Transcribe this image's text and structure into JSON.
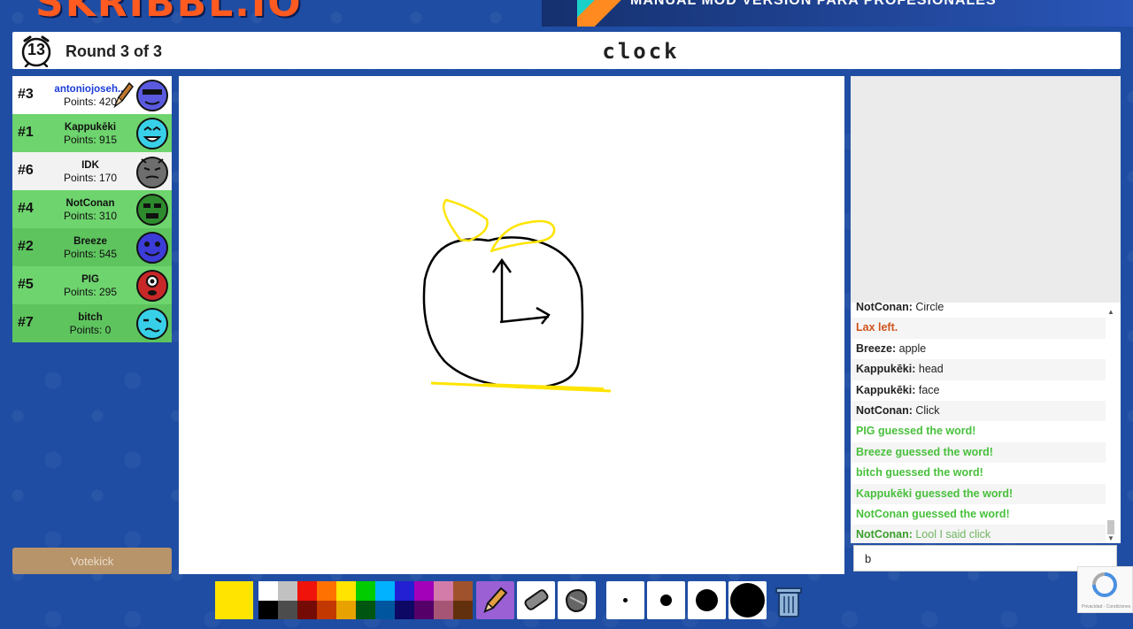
{
  "app": {
    "logo_text": "SKRIBBL.IO",
    "banner_text": "MANUAL MOD  VERSION PARA PROFESIONALES"
  },
  "header": {
    "timer": "13",
    "round": "Round 3 of 3",
    "word": "clock"
  },
  "players": [
    {
      "rank": "#3",
      "name": "antoniojoseh...",
      "points": "Points: 420",
      "drawing": true,
      "avatar_color": "#5a5ae0"
    },
    {
      "rank": "#1",
      "name": "Kappukēki",
      "points": "Points: 915",
      "avatar_color": "#38d0e8"
    },
    {
      "rank": "#6",
      "name": "IDK",
      "points": "Points: 170",
      "avatar_color": "#6e6e6e"
    },
    {
      "rank": "#4",
      "name": "NotConan",
      "points": "Points: 310",
      "avatar_color": "#2d8a2d"
    },
    {
      "rank": "#2",
      "name": "Breeze",
      "points": "Points: 545",
      "avatar_color": "#3c3cd8"
    },
    {
      "rank": "#5",
      "name": "PIG",
      "points": "Points: 295",
      "avatar_color": "#c82828"
    },
    {
      "rank": "#7",
      "name": "bitch",
      "points": "Points: 0",
      "avatar_color": "#38d0e8"
    }
  ],
  "votekick_label": "Votekick",
  "chat": {
    "messages": [
      {
        "type": "normal",
        "who": "NotConan:",
        "text": "Circle"
      },
      {
        "type": "leave",
        "text": "Lax left."
      },
      {
        "type": "normal",
        "who": "Breeze:",
        "text": "apple"
      },
      {
        "type": "normal",
        "who": "Kappukēki:",
        "text": "head"
      },
      {
        "type": "normal",
        "who": "Kappukēki:",
        "text": "face"
      },
      {
        "type": "normal",
        "who": "NotConan:",
        "text": "Click"
      },
      {
        "type": "guess",
        "text": "PIG guessed the word!"
      },
      {
        "type": "guess",
        "text": "Breeze guessed the word!"
      },
      {
        "type": "guess",
        "text": "bitch guessed the word!"
      },
      {
        "type": "guess",
        "text": "Kappukēki guessed the word!"
      },
      {
        "type": "guess",
        "text": "NotConan guessed the word!"
      },
      {
        "type": "close",
        "who": "NotConan:",
        "text": "Lool I said click"
      }
    ],
    "input_value": "b"
  },
  "toolbar": {
    "current_color": "#ffe400",
    "palette_top": [
      "#ffffff",
      "#c1c1c1",
      "#ef130b",
      "#ff7100",
      "#ffe400",
      "#00cc00",
      "#00b2ff",
      "#231fd3",
      "#a300ba",
      "#d37caa",
      "#a0522d"
    ],
    "palette_bottom": [
      "#000000",
      "#4c4c4c",
      "#740b07",
      "#c23800",
      "#e8a200",
      "#005510",
      "#00569e",
      "#0e0865",
      "#550069",
      "#a75574",
      "#63300d"
    ],
    "tools": [
      "pencil-icon",
      "eraser-icon",
      "fill-bucket-icon"
    ],
    "active_tool": "pencil-icon",
    "brush_sizes": [
      "size-1",
      "size-2",
      "size-3",
      "size-4"
    ]
  },
  "recaptcha_text": "Privacidad - Condiciones"
}
